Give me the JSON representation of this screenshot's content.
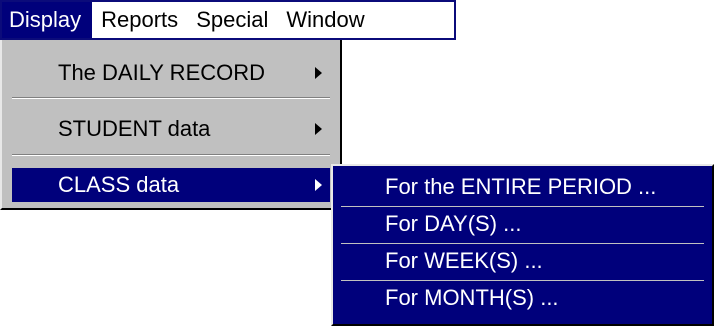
{
  "menubar": {
    "items": [
      {
        "label": "Display"
      },
      {
        "label": "Reports"
      },
      {
        "label": "Special"
      },
      {
        "label": "Window"
      }
    ]
  },
  "display_menu": {
    "items": [
      {
        "label": "The DAILY RECORD",
        "has_submenu": true
      },
      {
        "label": "STUDENT data",
        "has_submenu": true
      },
      {
        "label": "CLASS data",
        "has_submenu": true,
        "active": true
      }
    ]
  },
  "class_submenu": {
    "items": [
      {
        "label": "For the ENTIRE PERIOD ..."
      },
      {
        "label": "For DAY(S) ..."
      },
      {
        "label": "For WEEK(S) ..."
      },
      {
        "label": "For MONTH(S) ..."
      }
    ]
  },
  "colors": {
    "highlight": "#00007b",
    "menu_face": "#c0c0c0"
  }
}
